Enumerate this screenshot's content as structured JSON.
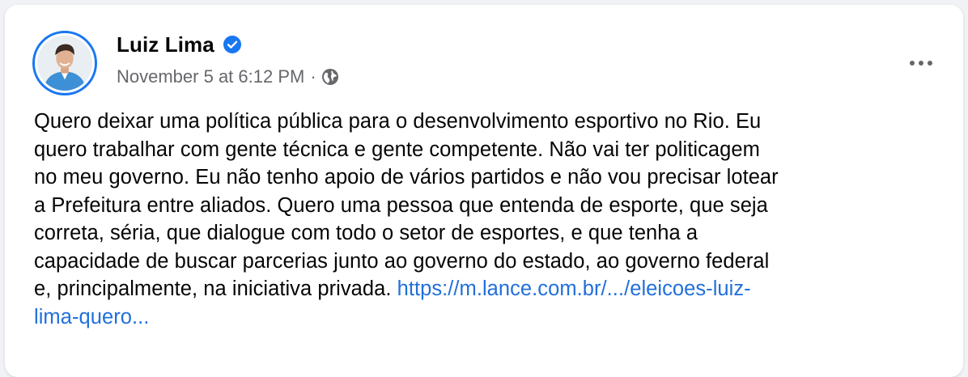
{
  "post": {
    "author": "Luiz Lima",
    "verified": true,
    "timestamp": "November 5 at 6:12 PM",
    "separator": "·",
    "audience_icon": "globe-icon",
    "lines": [
      "Quero deixar uma política pública para o desenvolvimento esportivo no Rio. Eu",
      "quero trabalhar com gente técnica e gente competente. Não vai ter politicagem",
      "no meu governo. Eu não tenho apoio de vários partidos e não vou precisar lotear",
      "a Prefeitura entre aliados. Quero uma pessoa que entenda de esporte, que seja",
      "correta, séria, que dialogue com todo o setor de esportes, e que tenha a",
      "capacidade de buscar parcerias junto ao governo do estado, ao governo federal",
      "e, principalmente, na iniciativa privada. "
    ],
    "link_part1": "https://m.lance.com.br/.../eleicoes-luiz-",
    "link_part2": "lima-quero..."
  },
  "colors": {
    "brand_blue": "#1877f2",
    "link": "#216fdb",
    "secondary_text": "#65676b",
    "primary_text": "#050505",
    "page_bg": "#f0f2f5"
  }
}
